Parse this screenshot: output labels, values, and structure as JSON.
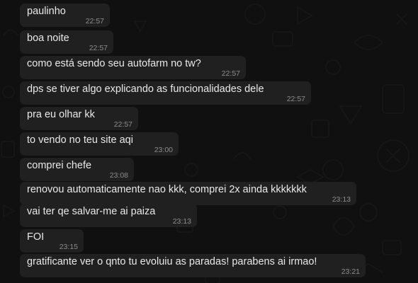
{
  "chat": {
    "messages": [
      {
        "text": "paulinho",
        "time": "22:57"
      },
      {
        "text": "boa noite",
        "time": "22:57"
      },
      {
        "text": "como está sendo seu autofarm no tw?",
        "time": "22:57"
      },
      {
        "text": "dps se tiver algo explicando as funcionalidades dele",
        "time": "22:57"
      },
      {
        "text": "pra eu olhar kk",
        "time": "22:57"
      },
      {
        "text": "to vendo no teu site aqi",
        "time": "23:00"
      },
      {
        "text": "comprei chefe",
        "time": "23:08"
      },
      {
        "text": "renovou automaticamente nao kkk, comprei 2x ainda kkkkkkk",
        "time": "23:13"
      },
      {
        "text": "vai ter qe salvar-me ai paiza",
        "time": "23:13"
      },
      {
        "text": "FOI",
        "time": "23:15"
      },
      {
        "text": "gratificante ver o qnto tu evoluiu as paradas! parabens ai irmao!",
        "time": "23:21"
      }
    ]
  }
}
